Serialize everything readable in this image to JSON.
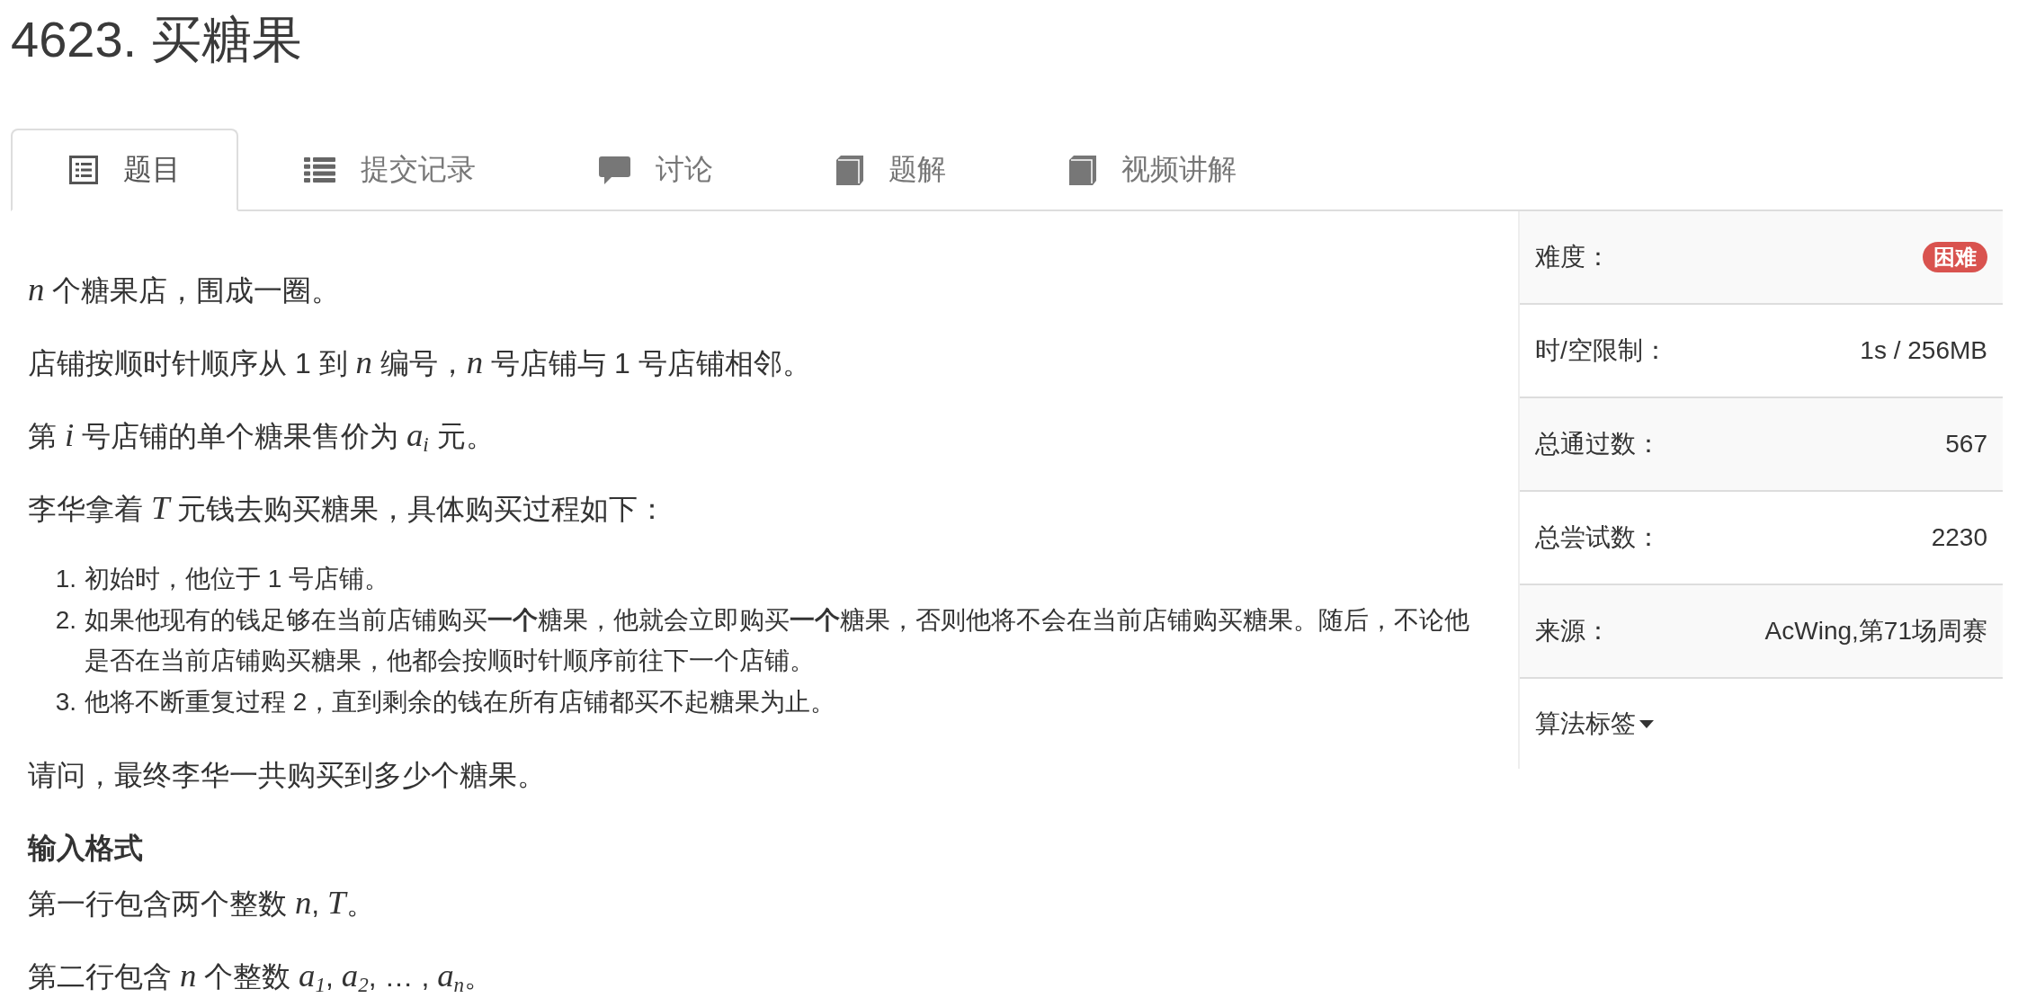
{
  "title": "4623. 买糖果",
  "tabs": [
    {
      "label": "题目",
      "selected": true
    },
    {
      "label": "提交记录",
      "selected": false
    },
    {
      "label": "讨论",
      "selected": false
    },
    {
      "label": "题解",
      "selected": false
    },
    {
      "label": "视频讲解",
      "selected": false
    }
  ],
  "statement": [
    {
      "kind": "paragraph",
      "text": "*n* 个糖果店，围成一圈。"
    },
    {
      "kind": "paragraph",
      "text": "店铺按顺时针顺序从 1 到 *n* 编号，*n* 号店铺与 1 号店铺相邻。"
    },
    {
      "kind": "paragraph",
      "text": "第 *i* 号店铺的单个糖果售价为 *a*$_{i}$ 元。"
    },
    {
      "kind": "paragraph",
      "text": "李华拿着 *T* 元钱去购买糖果，具体购买过程如下："
    },
    {
      "kind": "ordered_list",
      "items": [
        {
          "number": "1.",
          "text": "初始时，他位于 1 号店铺。"
        },
        {
          "number": "2.",
          "text": "如果他现有的钱足够在当前店铺购买**一个**糖果，他就会立即购买**一个**糖果，否则他将不会在当前店铺购买糖果。随后，不论他是否在当前店铺购买糖果，他都会按顺时针顺序前往下一个店铺。"
        },
        {
          "number": "3.",
          "text": "他将不断重复过程 2，直到剩余的钱在所有店铺都买不起糖果为止。"
        }
      ]
    },
    {
      "kind": "paragraph",
      "text": "请问，最终李华一共购买到多少个糖果。"
    },
    {
      "kind": "heading",
      "text": "输入格式"
    },
    {
      "kind": "paragraph",
      "text": "第一行包含两个整数 *n*, *T*。"
    },
    {
      "kind": "paragraph",
      "text": "第二行包含 *n* 个整数 *a*$_{1}$, *a*$_{2}$, … , *a*$_{n}$。"
    }
  ],
  "info": {
    "rows": [
      {
        "kind": "badge",
        "label": "难度：",
        "value": "困难",
        "color": "#d9534f"
      },
      {
        "kind": "text",
        "label": "时/空限制：",
        "value": "1s / 256MB"
      },
      {
        "kind": "text",
        "label": "总通过数：",
        "value": "567"
      },
      {
        "kind": "text",
        "label": "总尝试数：",
        "value": "2230"
      },
      {
        "kind": "text",
        "label": "来源：",
        "value": "AcWing,第71场周赛"
      }
    ],
    "tags_toggle": {
      "label": "算法标签"
    }
  }
}
